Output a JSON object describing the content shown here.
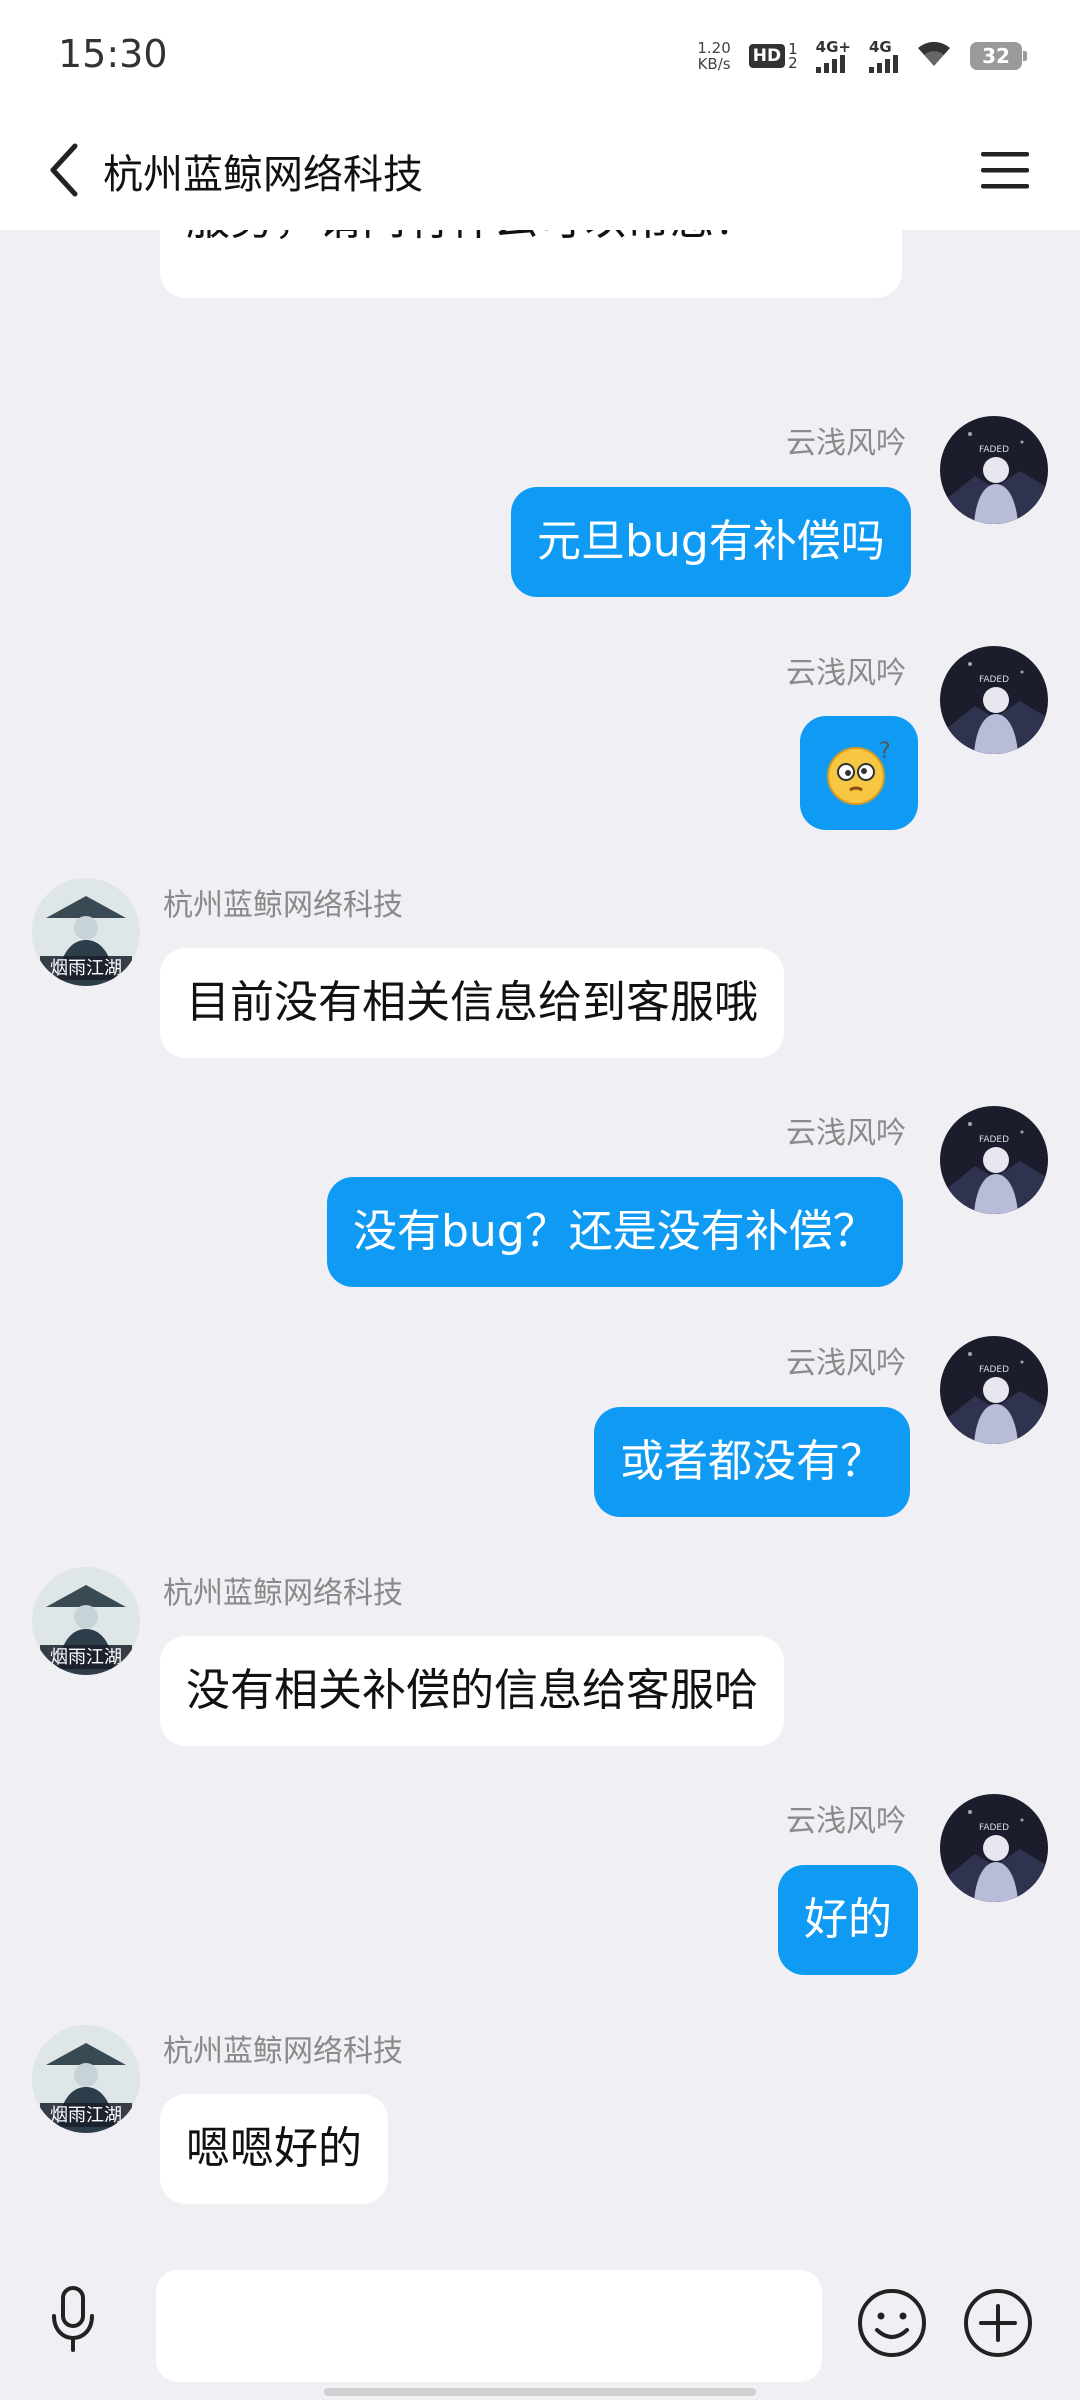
{
  "status_bar": {
    "time": "15:30",
    "net_speed_value": "1.20",
    "net_speed_unit": "KB/s",
    "hd_label": "HD",
    "hd_sub_top": "1",
    "hd_sub_bottom": "2",
    "sim1_label": "4G+",
    "sim2_label": "4G",
    "battery": "32"
  },
  "header": {
    "title": "杭州蓝鲸网络科技",
    "back_icon": "chevron-left-icon",
    "menu_icon": "hamburger-menu-icon"
  },
  "messages": [
    {
      "side": "in",
      "text": "服务，请问有什么可以帮您？",
      "partial": true
    },
    {
      "side": "out",
      "sender": "云浅风吟",
      "text": "元旦bug有补偿吗"
    },
    {
      "side": "out",
      "sender": "云浅风吟",
      "emoji": "confused-face-emoji"
    },
    {
      "side": "in",
      "sender": "杭州蓝鲸网络科技",
      "text": "目前没有相关信息给到客服哦"
    },
    {
      "side": "out",
      "sender": "云浅风吟",
      "text": "没有bug？还是没有补偿？"
    },
    {
      "side": "out",
      "sender": "云浅风吟",
      "text": "或者都没有？"
    },
    {
      "side": "in",
      "sender": "杭州蓝鲸网络科技",
      "text": "没有相关补偿的信息给客服哈"
    },
    {
      "side": "out",
      "sender": "云浅风吟",
      "text": "好的"
    },
    {
      "side": "in",
      "sender": "杭州蓝鲸网络科技",
      "text": "嗯嗯好的"
    }
  ],
  "avatars": {
    "self_caption": "FADED",
    "other_caption": "烟雨江湖"
  },
  "input_bar": {
    "placeholder": "",
    "mic_icon": "microphone-icon",
    "emoji_icon": "smiley-icon",
    "plus_icon": "plus-circle-icon"
  },
  "colors": {
    "outgoing_bubble": "#0f9af4",
    "incoming_bubble": "#ffffff",
    "chat_background": "#efeff4"
  }
}
